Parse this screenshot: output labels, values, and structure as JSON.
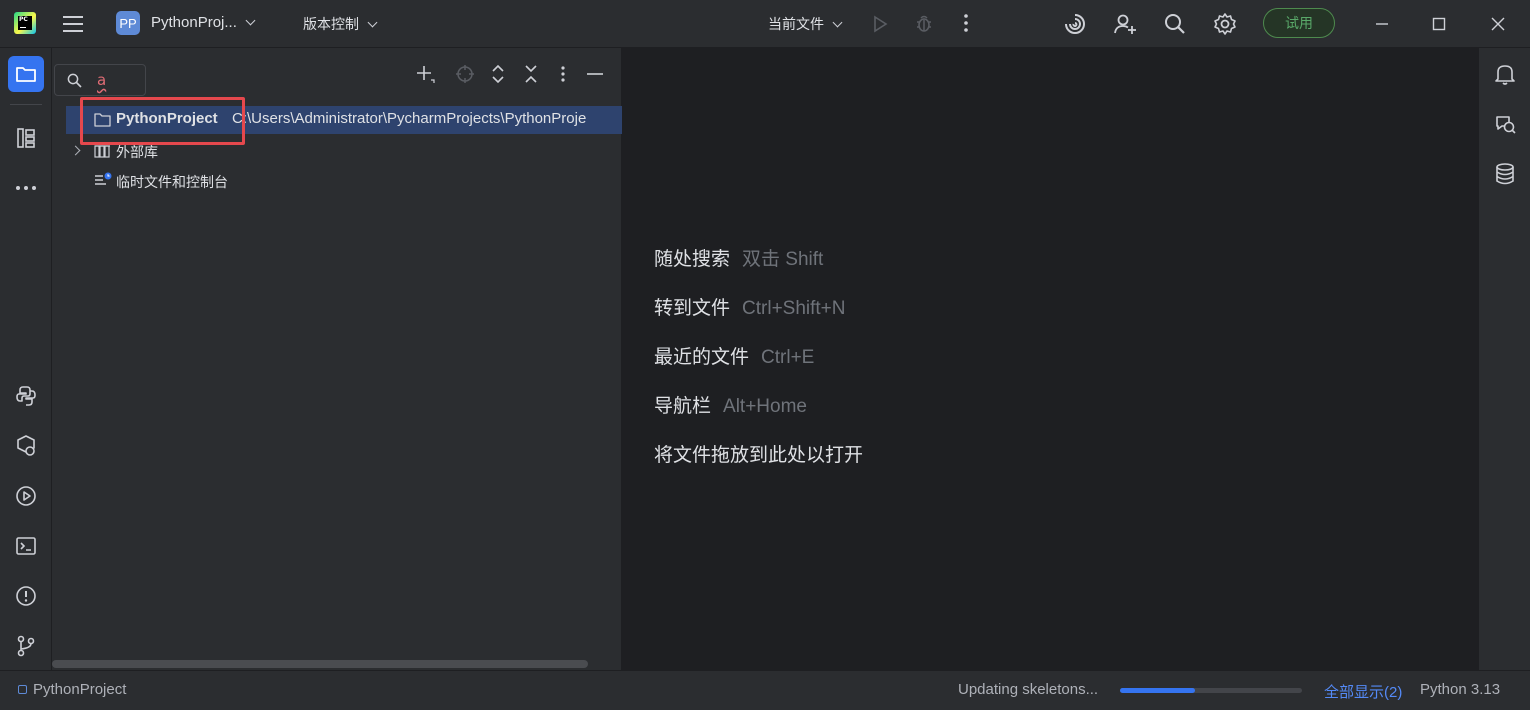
{
  "titlebar": {
    "app_logo_text": "PC",
    "project_badge": "PP",
    "project_name": "PythonProj...",
    "vcs_label": "版本控制",
    "run_config": "当前文件",
    "trial_label": "试用"
  },
  "project_panel": {
    "search_query": "a",
    "tree": [
      {
        "label": "PythonProject",
        "path": "C:\\Users\\Administrator\\PycharmProjects\\PythonProje",
        "icon": "folder-icon",
        "selected": true
      },
      {
        "label": "外部库",
        "icon": "library-icon",
        "expandable": true
      },
      {
        "label": "临时文件和控制台",
        "icon": "scratches-icon"
      }
    ]
  },
  "editor": {
    "hints": [
      {
        "action": "随处搜索",
        "shortcut": "双击 Shift"
      },
      {
        "action": "转到文件",
        "shortcut": "Ctrl+Shift+N"
      },
      {
        "action": "最近的文件",
        "shortcut": "Ctrl+E"
      },
      {
        "action": "导航栏",
        "shortcut": "Alt+Home"
      },
      {
        "action": "将文件拖放到此处以打开",
        "shortcut": ""
      }
    ]
  },
  "statusbar": {
    "breadcrumb": "PythonProject",
    "task_text": "Updating skeletons...",
    "progress": 0.41,
    "show_all": "全部显示(2)",
    "interpreter": "Python 3.13"
  },
  "colors": {
    "accent": "#3574f0",
    "selection": "#2e436e",
    "highlight_box": "#e5484d",
    "trial_green": "#59a869"
  }
}
